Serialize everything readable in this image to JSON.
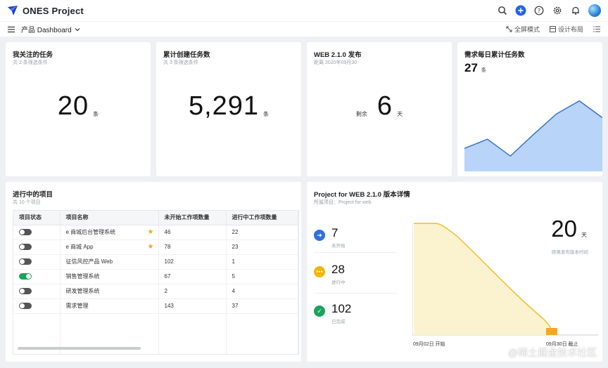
{
  "app": {
    "title": "ONES Project"
  },
  "header": {
    "icons": [
      "search-icon",
      "add-icon",
      "help-icon",
      "gear-icon",
      "bell-icon",
      "avatar"
    ]
  },
  "subbar": {
    "dashboard": "产品 Dashboard",
    "fullscreen": "全屏模式",
    "design_layout": "设计布局"
  },
  "cards": {
    "followed": {
      "title": "我关注的任务",
      "sub": "共 2 条筛选条件",
      "value": "20",
      "unit": "条"
    },
    "created": {
      "title": "累计创建任务数",
      "sub": "共 3 条筛选条件",
      "value": "5,291",
      "unit": "条"
    },
    "release": {
      "title": "WEB 2.1.0 发布",
      "sub": "距离 2020年09月30",
      "prefix": "剩余",
      "value": "6",
      "unit": "天"
    },
    "daily": {
      "title": "需求每日累计任务数",
      "value": "27",
      "unit": "条"
    }
  },
  "chart_data": {
    "type": "area",
    "values": [
      30,
      42,
      20,
      48,
      75,
      92,
      70
    ],
    "ylim": [
      0,
      110
    ],
    "color": "#b8d4f8",
    "line_color": "#3b73c9"
  },
  "projects": {
    "title": "进行中的项目",
    "sub": "共 10 个项目",
    "headers": [
      "项目状态",
      "项目名称",
      "未开始工作项数量",
      "进行中工作项数量"
    ],
    "rows": [
      {
        "on": false,
        "name": "e 商城后台管理系统",
        "star": true,
        "todo": "46",
        "doing": "22"
      },
      {
        "on": false,
        "name": "e 商城 App",
        "star": true,
        "todo": "78",
        "doing": "23"
      },
      {
        "on": false,
        "name": "征信风控产品 Web",
        "star": false,
        "todo": "102",
        "doing": "1"
      },
      {
        "on": true,
        "name": "销售管理系统",
        "star": false,
        "todo": "67",
        "doing": "5"
      },
      {
        "on": false,
        "name": "研发管理系统",
        "star": false,
        "todo": "2",
        "doing": "4"
      },
      {
        "on": false,
        "name": "需求管理",
        "star": false,
        "todo": "143",
        "doing": "37"
      }
    ]
  },
  "detail": {
    "title": "Project for WEB 2.1.0 版本详情",
    "sub": "所属项目：Project for web",
    "stats": [
      {
        "value": "7",
        "label": "未开始",
        "color": "#2f6fe0",
        "icon": "arrow-right-icon"
      },
      {
        "value": "28",
        "label": "进行中",
        "color": "#f5b400",
        "icon": "more-icon"
      },
      {
        "value": "102",
        "label": "已完成",
        "color": "#19a35b",
        "icon": "check-icon"
      }
    ],
    "countdown": {
      "value": "20",
      "unit": "天",
      "label": "距离发布版本时间"
    },
    "start_label": "09月02日 开始",
    "end_label": "09月30日 截止"
  },
  "watermark": "@稀土掘金技术社区"
}
